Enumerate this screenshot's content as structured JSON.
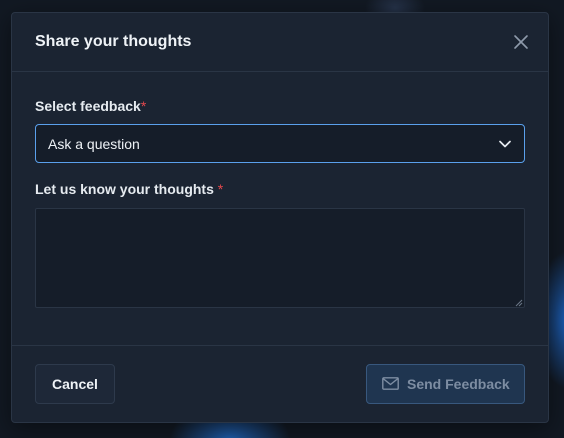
{
  "modal": {
    "title": "Share your thoughts",
    "close_icon": "close-icon"
  },
  "form": {
    "feedback_type": {
      "label": "Select feedback",
      "required_marker": "*",
      "selected_value": "Ask a question",
      "icon": "chevron-down-icon"
    },
    "thoughts": {
      "label": "Let us know your thoughts",
      "required_marker": "*",
      "value": ""
    }
  },
  "footer": {
    "cancel_label": "Cancel",
    "send_label": "Send Feedback",
    "send_icon": "mail-icon",
    "send_disabled": true
  },
  "colors": {
    "background": "#121923",
    "modal": "#1b2432",
    "focus_border": "#5aa0ec",
    "required": "#e5484d",
    "send_button": "#1f3550"
  }
}
